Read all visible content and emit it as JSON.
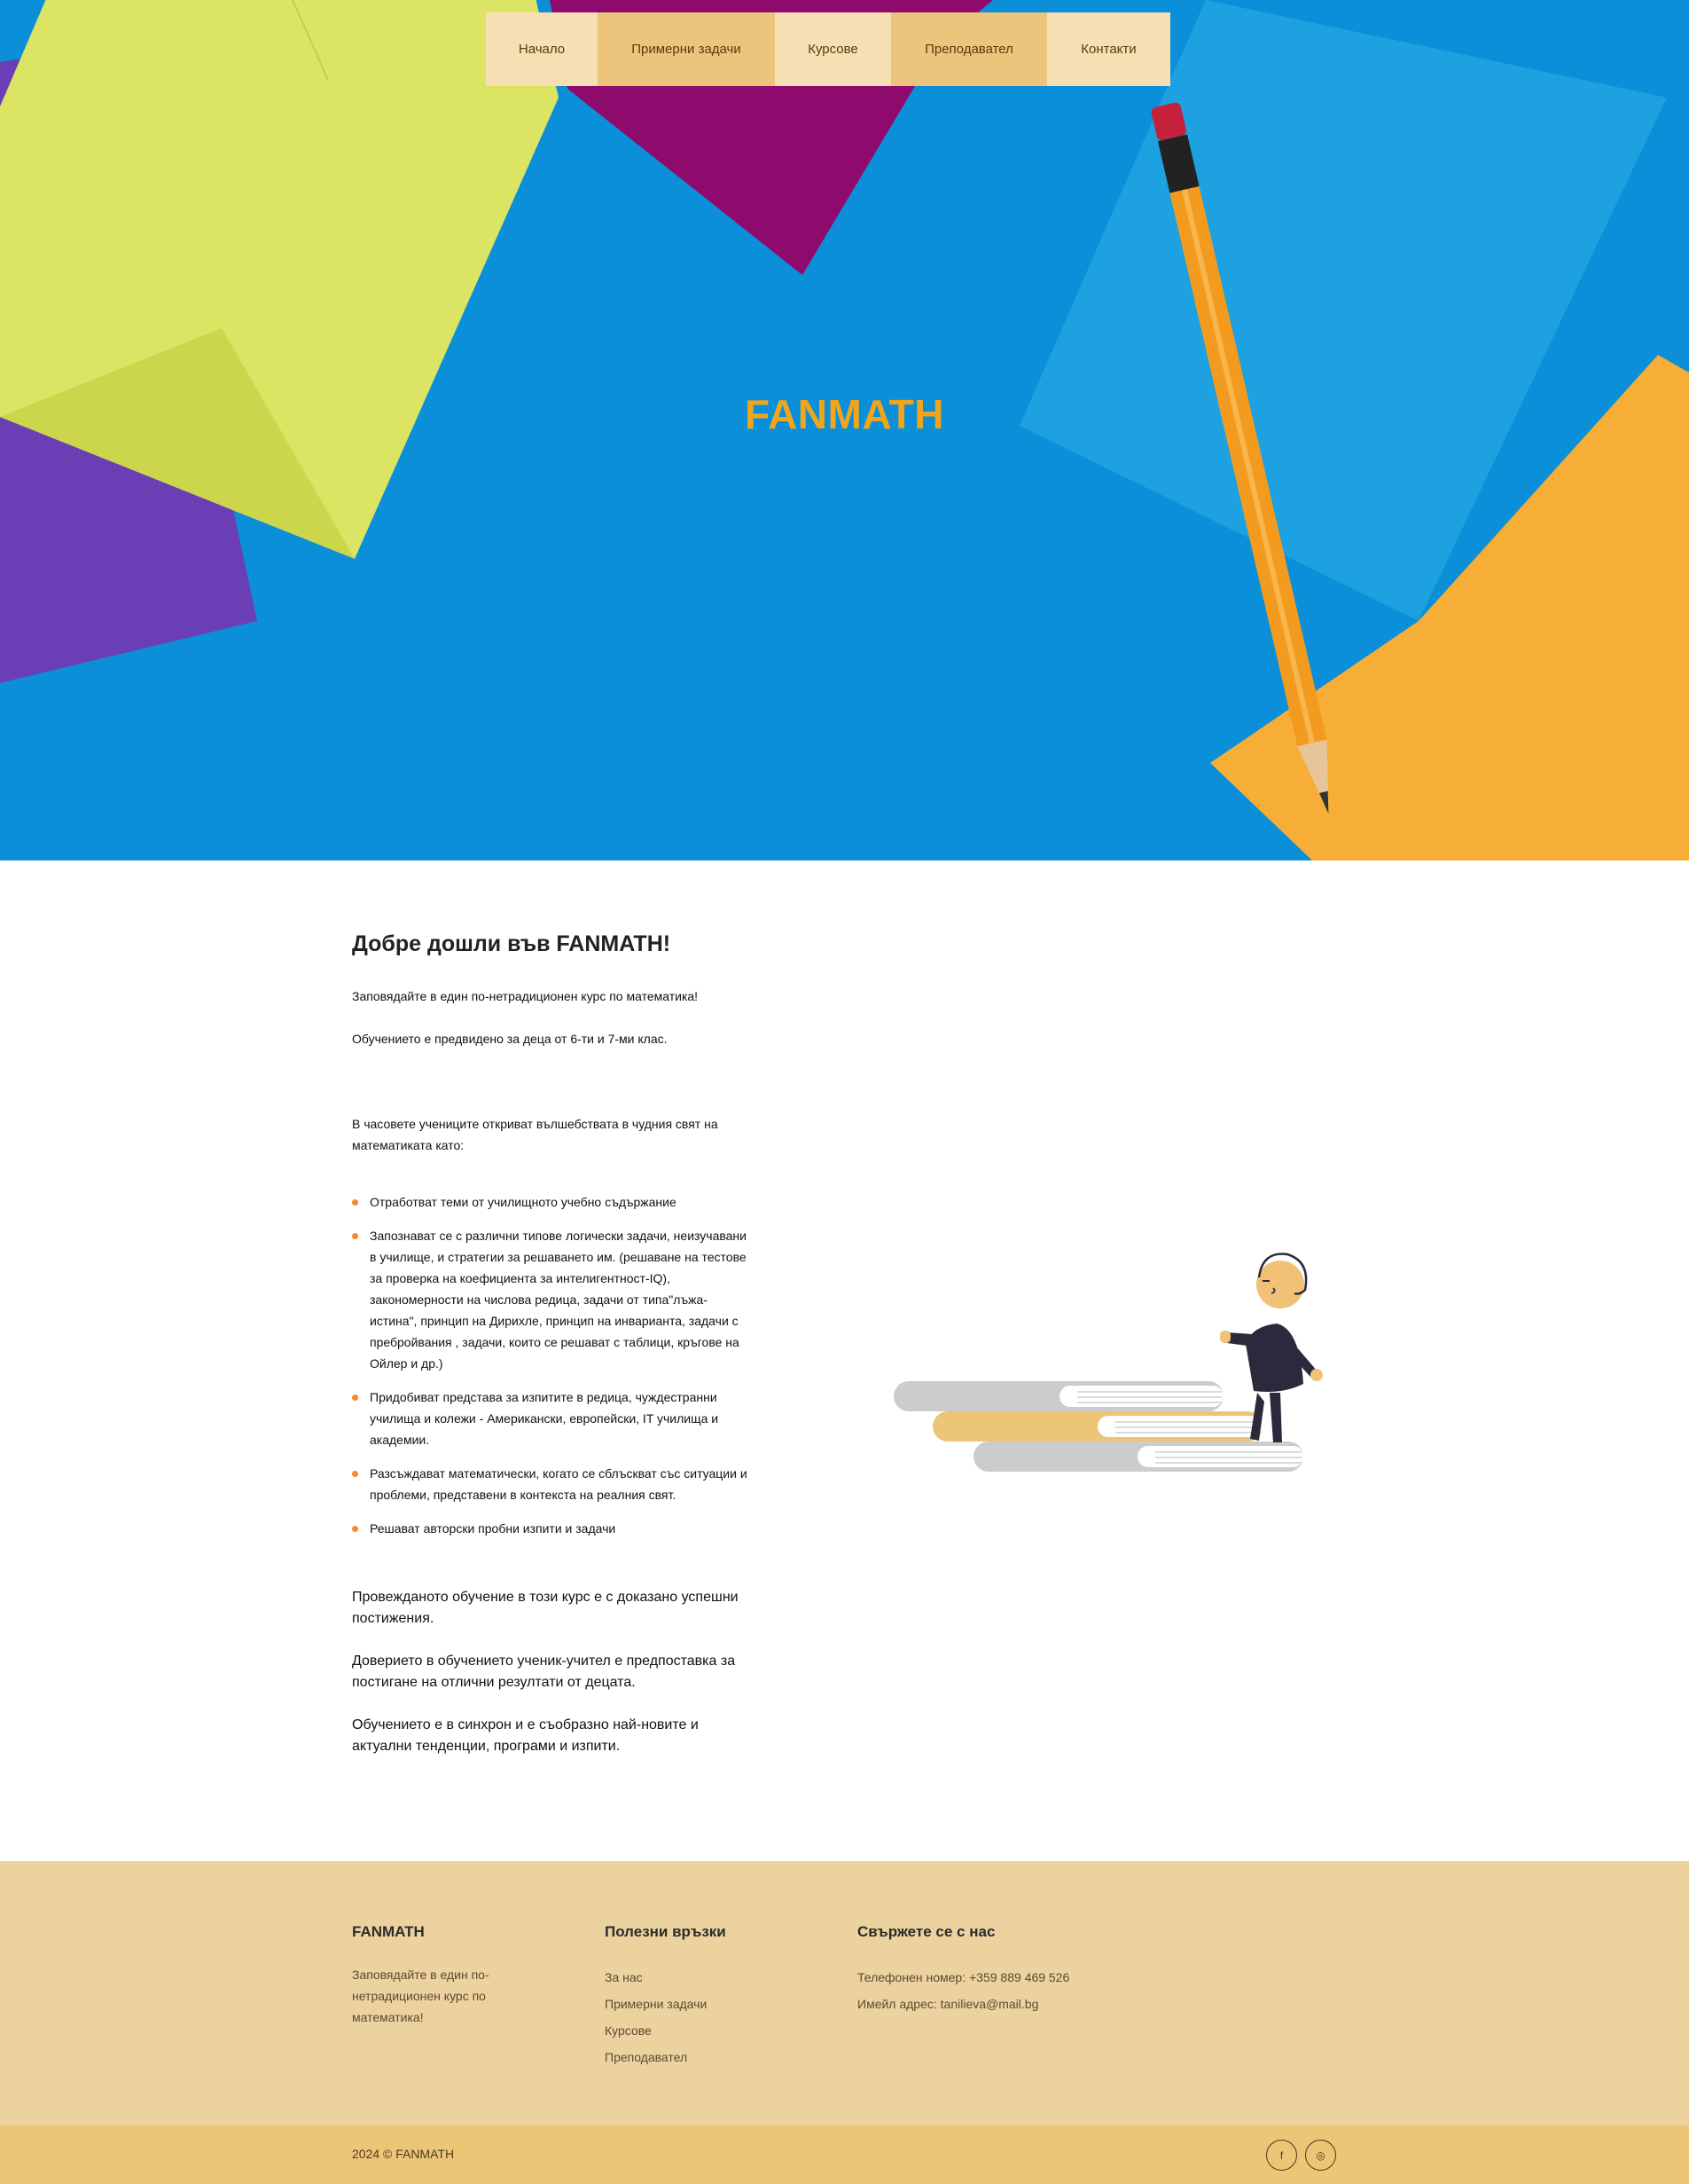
{
  "nav": {
    "items": [
      {
        "label": "Начало"
      },
      {
        "label": "Примерни задачи"
      },
      {
        "label": "Курсове"
      },
      {
        "label": "Преподавател"
      },
      {
        "label": "Контакти"
      }
    ]
  },
  "hero": {
    "title": "FANMATH",
    "background": "blue-paper-envelopes-pencil"
  },
  "intro": {
    "heading": "Добре дошли във FANMATH!",
    "lead1": "Заповядайте в един по-нетрадиционен курс по математика!",
    "lead2": "Обучението е предвидено за деца от 6-ти и 7-ми клас.",
    "lead3": "В часовете учениците откриват вълшебствата в чудния свят на математиката като:",
    "bullets": [
      "Отработват теми от училищното учебно съдържание",
      "Запознават се с различни типове логически задачи, неизучавани в училище, и стратегии за решаването им. (решаване на тестове за проверка на коефициента за интелигентност-IQ), закономерности на числова редица, задачи от типа\"лъжа-истина\", принцип на Дирихле, принцип на инварианта, задачи с пребройвания , задачи, които се решават с таблици, кръгове на Ойлер и др.)",
      "Придобиват представа за изпитите в редица, чуждестранни училища и колежи - Американски, европейски, IT училища и академии.",
      "Разсъждават математически, когато се сблъскват със ситуации и проблеми, представени в контекста на реалния свят.",
      "Решават авторски пробни изпити и задачи"
    ],
    "closing1": "Провежданото обучение в този курс е с доказано успешни постижения.",
    "closing2": "Доверието в обучението ученик-учител е предпоставка за постигане на отлични резултати от децата.",
    "closing3": "Обучението е в синхрон и е съобразно най-новите и актуални тенденции, програми и изпити."
  },
  "illustration": {
    "icon": "boy-climbing-books-illustration"
  },
  "footer": {
    "brand": {
      "title": "FANMATH",
      "text": "Заповядайте в един по-нетрадиционен курс по математика!"
    },
    "links": {
      "title": "Полезни връзки",
      "items": [
        "За нас",
        "Примерни задачи",
        "Курсове",
        "Преподавател"
      ]
    },
    "contact": {
      "title": "Свържете се с нас",
      "phone": "Телефонен номер: +359 889 469 526",
      "email": "Имейл адрес: tanilieva@mail.bg"
    },
    "copyright": "2024 © FANMATH",
    "social": [
      {
        "icon": "facebook-icon",
        "glyph": "f"
      },
      {
        "icon": "instagram-icon",
        "glyph": "◎"
      }
    ]
  },
  "colors": {
    "accent": "#f2a51a",
    "nav_light": "#f6dfb3",
    "nav_dark": "#edc47c",
    "footer_bg": "#ecd29e",
    "bottom_bar": "#edc577",
    "bullet": "#ef8b2c"
  }
}
